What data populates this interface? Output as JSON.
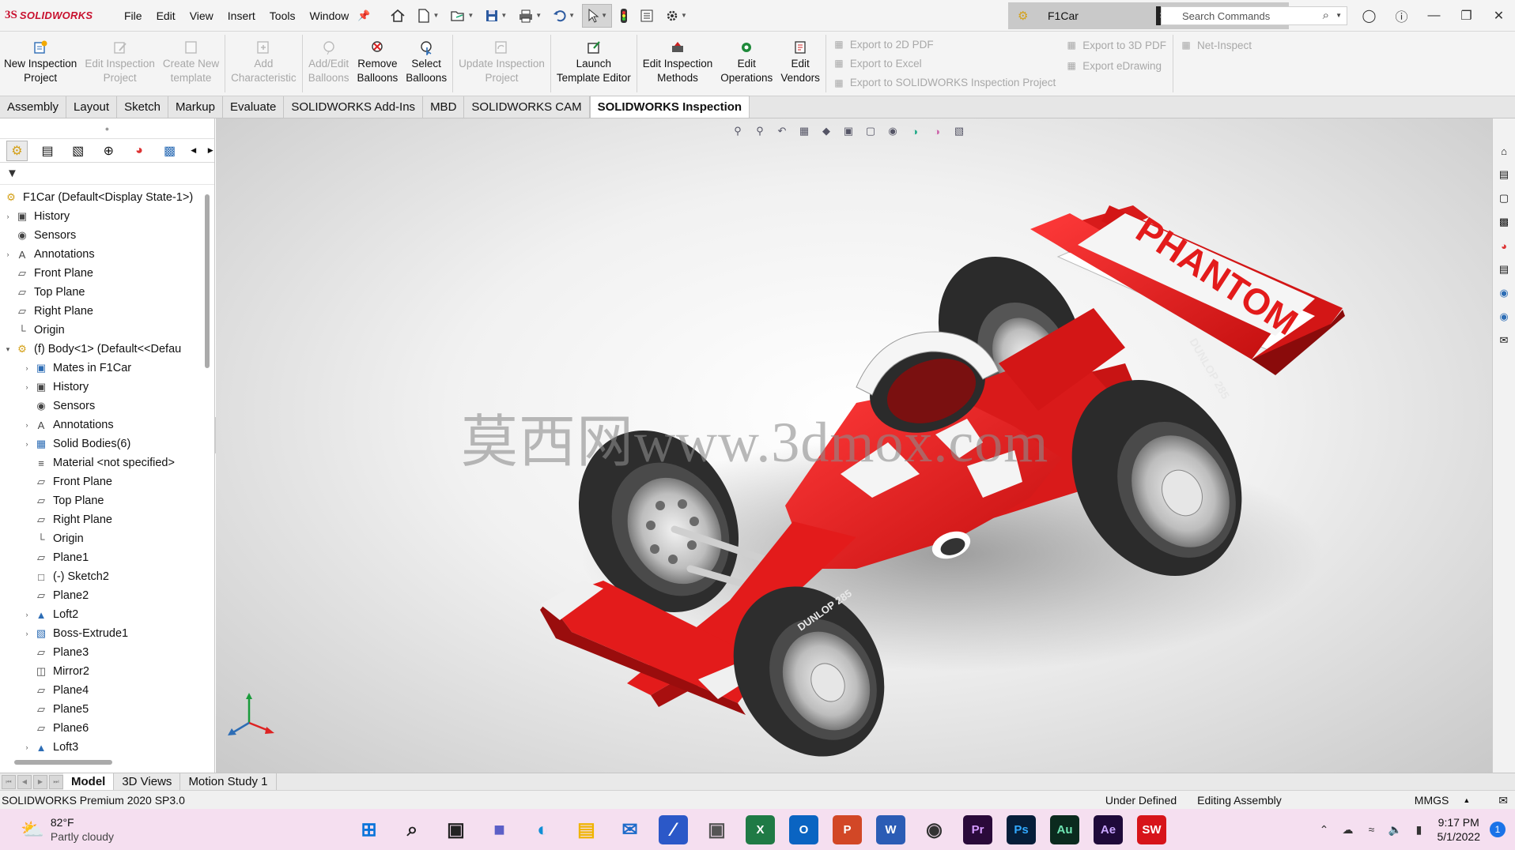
{
  "app": {
    "logo_prefix": "3S",
    "logo_text": "SOLIDWORKS",
    "menus": [
      "File",
      "Edit",
      "View",
      "Insert",
      "Tools",
      "Window"
    ],
    "document_name": "F1Car",
    "search_placeholder": "Search Commands"
  },
  "ribbon": {
    "buttons": [
      {
        "label1": "New Inspection",
        "label2": "Project",
        "enabled": true
      },
      {
        "label1": "Edit Inspection",
        "label2": "Project",
        "enabled": false
      },
      {
        "label1": "Create New",
        "label2": "template",
        "enabled": false
      },
      {
        "label1": "Add",
        "label2": "Characteristic",
        "enabled": false
      },
      {
        "label1": "Add/Edit",
        "label2": "Balloons",
        "enabled": false
      },
      {
        "label1": "Remove",
        "label2": "Balloons",
        "enabled": true
      },
      {
        "label1": "Select",
        "label2": "Balloons",
        "enabled": true
      },
      {
        "label1": "Update Inspection",
        "label2": "Project",
        "enabled": false
      },
      {
        "label1": "Launch",
        "label2": "Template Editor",
        "enabled": true
      },
      {
        "label1": "Edit Inspection",
        "label2": "Methods",
        "enabled": true
      },
      {
        "label1": "Edit",
        "label2": "Operations",
        "enabled": true
      },
      {
        "label1": "Edit",
        "label2": "Vendors",
        "enabled": true
      }
    ],
    "export": {
      "pdf2d": "Export to 2D PDF",
      "excel": "Export to Excel",
      "sw_project": "Export to SOLIDWORKS Inspection Project",
      "pdf3d": "Export to 3D PDF",
      "edrawing": "Export eDrawing",
      "net_inspect": "Net-Inspect"
    }
  },
  "tabs": [
    "Assembly",
    "Layout",
    "Sketch",
    "Markup",
    "Evaluate",
    "SOLIDWORKS Add-Ins",
    "MBD",
    "SOLIDWORKS CAM",
    "SOLIDWORKS Inspection"
  ],
  "active_tab": "SOLIDWORKS Inspection",
  "tree": {
    "root": "F1Car  (Default<Display State-1>)",
    "items": [
      {
        "label": "History",
        "expand": true,
        "icon": "history-icon"
      },
      {
        "label": "Sensors",
        "expand": false,
        "icon": "sensors-icon"
      },
      {
        "label": "Annotations",
        "expand": true,
        "icon": "annotations-icon"
      },
      {
        "label": "Front Plane",
        "expand": false,
        "icon": "plane-icon"
      },
      {
        "label": "Top Plane",
        "expand": false,
        "icon": "plane-icon"
      },
      {
        "label": "Right Plane",
        "expand": false,
        "icon": "plane-icon"
      },
      {
        "label": "Origin",
        "expand": false,
        "icon": "origin-icon"
      },
      {
        "label": "(f) Body<1> (Default<<Defau",
        "expand": "open",
        "icon": "assembly-icon"
      }
    ],
    "children": [
      {
        "label": "Mates in F1Car",
        "expand": true,
        "icon": "mates-icon"
      },
      {
        "label": "History",
        "expand": true,
        "icon": "history-icon"
      },
      {
        "label": "Sensors",
        "expand": false,
        "icon": "sensors-icon"
      },
      {
        "label": "Annotations",
        "expand": true,
        "icon": "annotations-icon"
      },
      {
        "label": "Solid Bodies(6)",
        "expand": true,
        "icon": "solid-bodies-icon"
      },
      {
        "label": "Material <not specified>",
        "expand": false,
        "icon": "material-icon"
      },
      {
        "label": "Front Plane",
        "expand": false,
        "icon": "plane-icon"
      },
      {
        "label": "Top Plane",
        "expand": false,
        "icon": "plane-icon"
      },
      {
        "label": "Right Plane",
        "expand": false,
        "icon": "plane-icon"
      },
      {
        "label": "Origin",
        "expand": false,
        "icon": "origin-icon"
      },
      {
        "label": "Plane1",
        "expand": false,
        "icon": "plane-icon"
      },
      {
        "label": "(-) Sketch2",
        "expand": false,
        "icon": "sketch-icon"
      },
      {
        "label": "Plane2",
        "expand": false,
        "icon": "plane-icon"
      },
      {
        "label": "Loft2",
        "expand": true,
        "icon": "loft-icon"
      },
      {
        "label": "Boss-Extrude1",
        "expand": true,
        "icon": "extrude-icon"
      },
      {
        "label": "Plane3",
        "expand": false,
        "icon": "plane-icon"
      },
      {
        "label": "Mirror2",
        "expand": false,
        "icon": "mirror-icon"
      },
      {
        "label": "Plane4",
        "expand": false,
        "icon": "plane-icon"
      },
      {
        "label": "Plane5",
        "expand": false,
        "icon": "plane-icon"
      },
      {
        "label": "Plane6",
        "expand": false,
        "icon": "plane-icon"
      },
      {
        "label": "Loft3",
        "expand": true,
        "icon": "loft-icon"
      }
    ]
  },
  "viewport": {
    "wing_text": "PHANTOM",
    "tire_text": "DUNLOP 285",
    "watermark": "莫西网www.3dmox.com",
    "colors": {
      "body": "#e31b1b",
      "body_dark": "#a80f0f",
      "tire": "#2d2d2d",
      "wing_panel": "#f7f7f7"
    }
  },
  "bottom_tabs": [
    "Model",
    "3D Views",
    "Motion Study 1"
  ],
  "active_bottom_tab": "Model",
  "status": {
    "product": "SOLIDWORKS Premium 2020 SP3.0",
    "state": "Under Defined",
    "mode": "Editing Assembly",
    "units": "MMGS"
  },
  "taskbar": {
    "temperature": "82°F",
    "weather": "Partly cloudy",
    "time": "9:17 PM",
    "date": "5/1/2022",
    "notifications": "1",
    "apps": [
      {
        "name": "start-button",
        "label": "",
        "bg": "transparent",
        "fg": "#0a74da"
      },
      {
        "name": "search-app",
        "label": "",
        "bg": "transparent",
        "fg": "#222"
      },
      {
        "name": "task-view-app",
        "label": "",
        "bg": "transparent",
        "fg": "#222"
      },
      {
        "name": "teams-app",
        "label": "",
        "bg": "transparent",
        "fg": "#5b5fc7"
      },
      {
        "name": "edge-app",
        "label": "",
        "bg": "transparent",
        "fg": "#0f8fd6"
      },
      {
        "name": "explorer-app",
        "label": "",
        "bg": "transparent",
        "fg": "#f0b400"
      },
      {
        "name": "mail-app",
        "label": "",
        "bg": "transparent",
        "fg": "#1b6ac9"
      },
      {
        "name": "calc-app",
        "label": "",
        "bg": "#2b58c8",
        "fg": "#fff"
      },
      {
        "name": "camera-app",
        "label": "",
        "bg": "transparent",
        "fg": "#555"
      },
      {
        "name": "excel-app",
        "label": "X",
        "bg": "#1f7a45",
        "fg": "#fff"
      },
      {
        "name": "outlook-app",
        "label": "O",
        "bg": "#0a64c2",
        "fg": "#fff"
      },
      {
        "name": "powerpoint-app",
        "label": "P",
        "bg": "#d24726",
        "fg": "#fff"
      },
      {
        "name": "word-app",
        "label": "W",
        "bg": "#2b5cb5",
        "fg": "#fff"
      },
      {
        "name": "chrome-app",
        "label": "",
        "bg": "transparent",
        "fg": "#333"
      },
      {
        "name": "premiere-app",
        "label": "Pr",
        "bg": "#2a0a3a",
        "fg": "#d49bff"
      },
      {
        "name": "photoshop-app",
        "label": "Ps",
        "bg": "#061e3a",
        "fg": "#31a8ff"
      },
      {
        "name": "audition-app",
        "label": "Au",
        "bg": "#0b2a1e",
        "fg": "#6fe5b3"
      },
      {
        "name": "aftereffects-app",
        "label": "Ae",
        "bg": "#1f0a3a",
        "fg": "#c9a6ff"
      },
      {
        "name": "solidworks-app",
        "label": "SW",
        "bg": "#d7141a",
        "fg": "#fff"
      }
    ]
  }
}
